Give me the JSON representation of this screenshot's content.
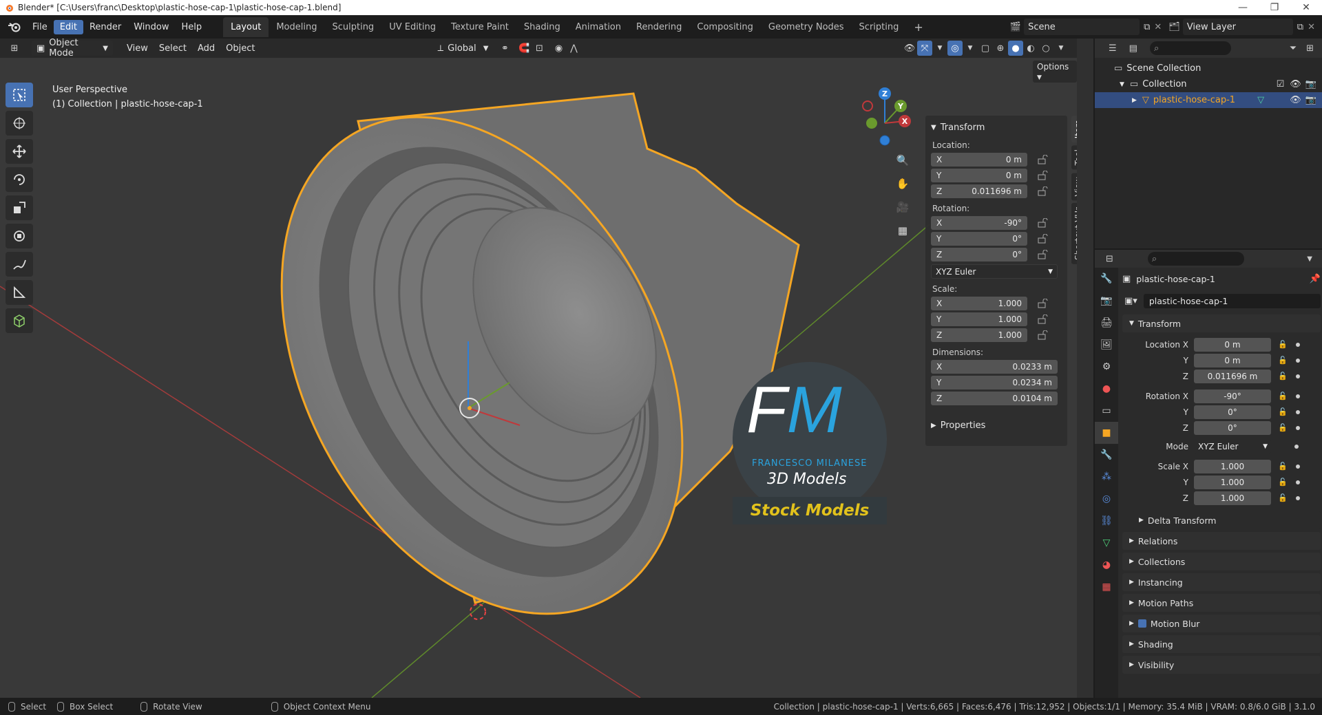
{
  "title_bar": {
    "text": "Blender* [C:\\Users\\franc\\Desktop\\plastic-hose-cap-1\\plastic-hose-cap-1.blend]"
  },
  "menu": [
    "File",
    "Edit",
    "Render",
    "Window",
    "Help"
  ],
  "workspaces": [
    "Layout",
    "Modeling",
    "Sculpting",
    "UV Editing",
    "Texture Paint",
    "Shading",
    "Animation",
    "Rendering",
    "Compositing",
    "Geometry Nodes",
    "Scripting"
  ],
  "scene": {
    "name": "Scene",
    "view_layer": "View Layer"
  },
  "viewport_header": {
    "mode": "Object Mode",
    "menus": [
      "View",
      "Select",
      "Add",
      "Object"
    ],
    "orientation": "Global",
    "options": "Options"
  },
  "viewport": {
    "perspective": "User Perspective",
    "collection_info": "(1) Collection | plastic-hose-cap-1",
    "gizmo_axes": {
      "z": "Z",
      "y": "Y",
      "x": "X"
    },
    "watermark": {
      "initials_f": "F",
      "initials_m": "M",
      "name": "FRANCESCO MILANESE",
      "sub": "3D Models",
      "banner": "Stock Models"
    }
  },
  "n_panel": {
    "title": "Transform",
    "location_label": "Location:",
    "location": [
      {
        "axis": "X",
        "value": "0 m"
      },
      {
        "axis": "Y",
        "value": "0 m"
      },
      {
        "axis": "Z",
        "value": "0.011696 m"
      }
    ],
    "rotation_label": "Rotation:",
    "rotation": [
      {
        "axis": "X",
        "value": "-90°"
      },
      {
        "axis": "Y",
        "value": "0°"
      },
      {
        "axis": "Z",
        "value": "0°"
      }
    ],
    "rotation_mode": "XYZ Euler",
    "scale_label": "Scale:",
    "scale": [
      {
        "axis": "X",
        "value": "1.000"
      },
      {
        "axis": "Y",
        "value": "1.000"
      },
      {
        "axis": "Z",
        "value": "1.000"
      }
    ],
    "dimensions_label": "Dimensions:",
    "dimensions": [
      {
        "axis": "X",
        "value": "0.0233 m"
      },
      {
        "axis": "Y",
        "value": "0.0234 m"
      },
      {
        "axis": "Z",
        "value": "0.0104 m"
      }
    ],
    "properties": "Properties",
    "tabs": [
      "Item",
      "Tool",
      "View",
      "Shortcut VUr"
    ]
  },
  "outliner": {
    "scene_collection": "Scene Collection",
    "collection": "Collection",
    "object": "plastic-hose-cap-1"
  },
  "properties": {
    "object_name": "plastic-hose-cap-1",
    "data_name": "plastic-hose-cap-1",
    "transform_title": "Transform",
    "rows": [
      {
        "label": "Location X",
        "value": "0 m"
      },
      {
        "label": "Y",
        "value": "0 m"
      },
      {
        "label": "Z",
        "value": "0.011696 m"
      },
      {
        "label": "Rotation X",
        "value": "-90°"
      },
      {
        "label": "Y",
        "value": "0°"
      },
      {
        "label": "Z",
        "value": "0°"
      },
      {
        "label": "Mode",
        "value": "XYZ Euler"
      },
      {
        "label": "Scale X",
        "value": "1.000"
      },
      {
        "label": "Y",
        "value": "1.000"
      },
      {
        "label": "Z",
        "value": "1.000"
      }
    ],
    "delta_transform": "Delta Transform",
    "subpanels": [
      "Relations",
      "Collections",
      "Instancing",
      "Motion Paths",
      "Motion Blur",
      "Shading",
      "Visibility"
    ]
  },
  "status_bar": {
    "select": "Select",
    "box_select": "Box Select",
    "rotate_view": "Rotate View",
    "context_menu": "Object Context Menu",
    "stats": "Collection | plastic-hose-cap-1 | Verts:6,665 | Faces:6,476 | Tris:12,952 | Objects:1/1 | Memory: 35.4 MiB | VRAM: 0.8/6.0 GiB | 3.1.0"
  },
  "colors": {
    "accent": "#4772b3",
    "selection_outline": "#f5a623",
    "x_axis": "#c0393b",
    "y_axis": "#6a9a2d",
    "z_axis": "#2f7fd6"
  }
}
